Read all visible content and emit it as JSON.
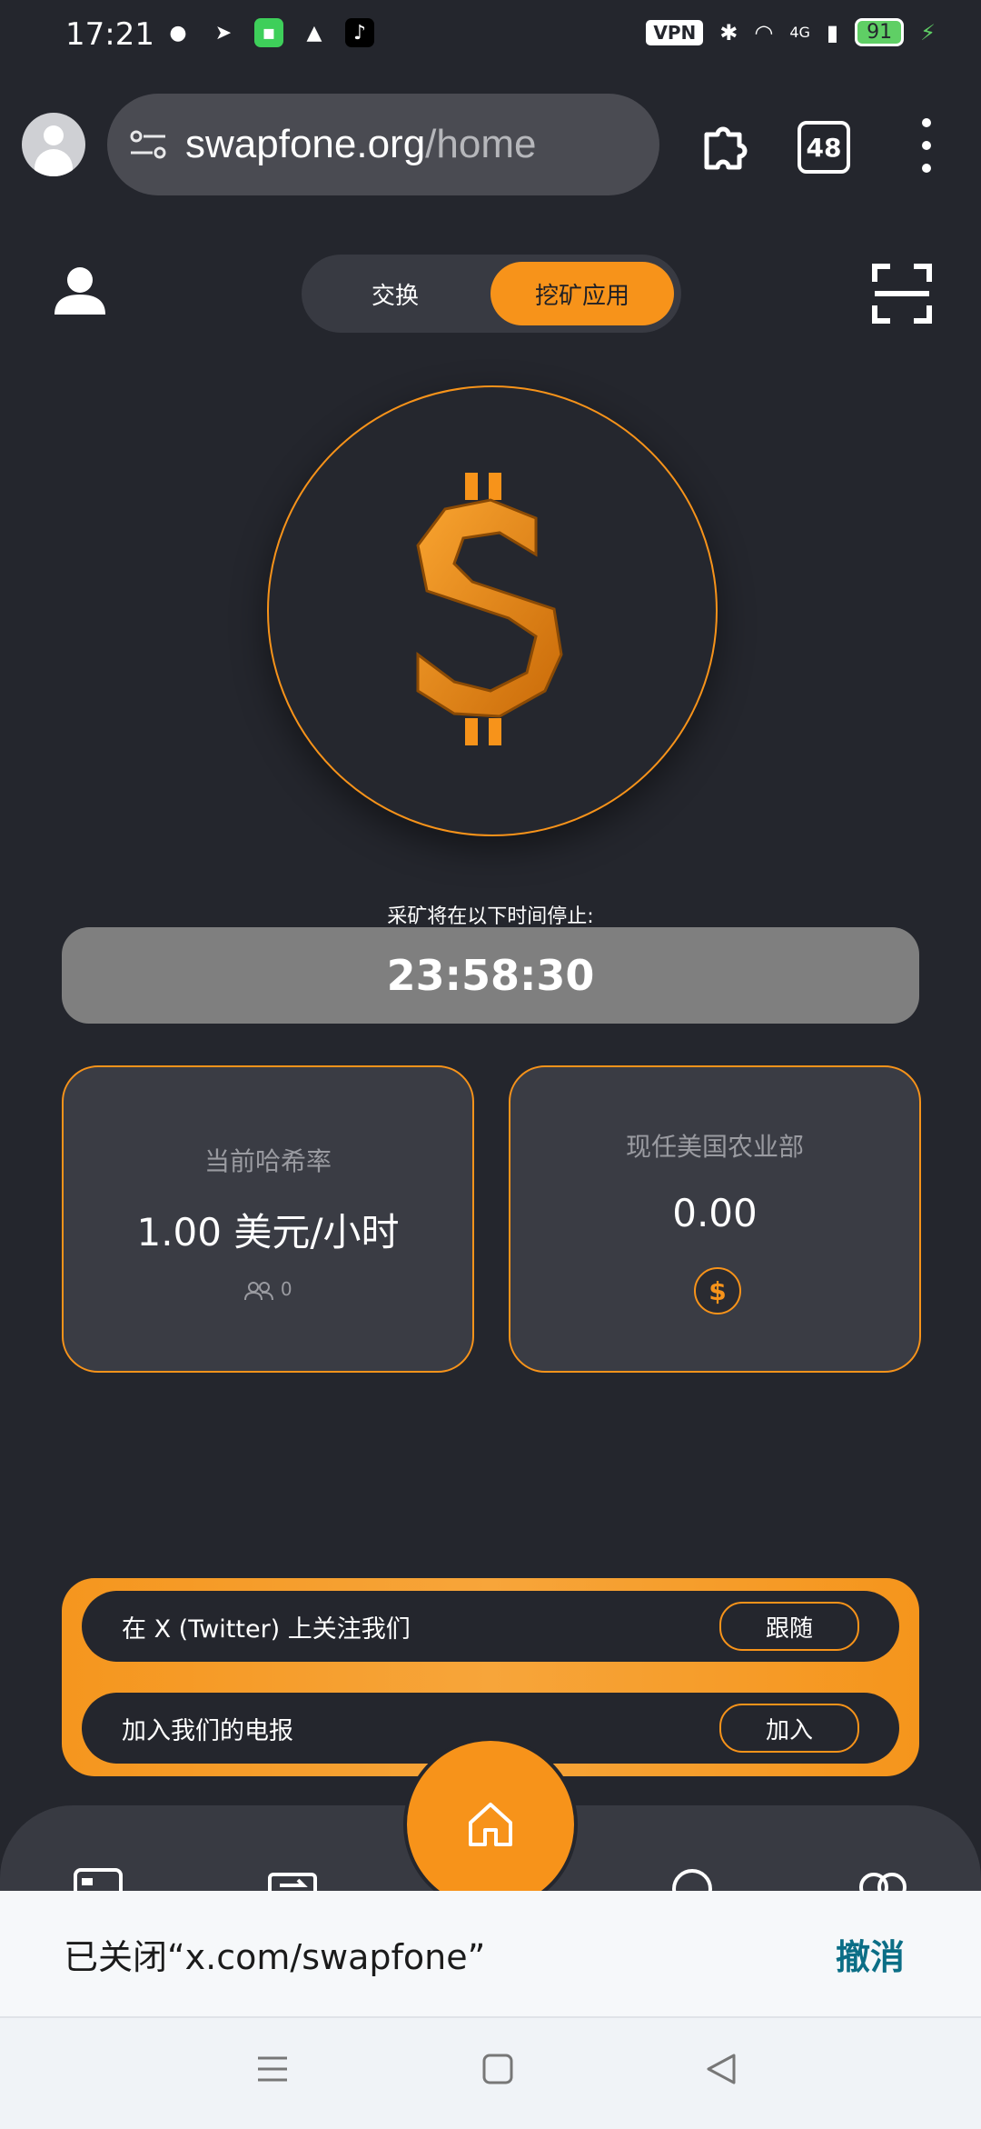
{
  "status_bar": {
    "time": "17:21",
    "vpn": "VPN",
    "network": "4G",
    "battery": "91"
  },
  "browser": {
    "url_domain": "swapfone.org",
    "url_path": "/home",
    "tab_count": "48"
  },
  "app": {
    "tabs": {
      "swap": "交换",
      "mining": "挖矿应用"
    },
    "timer_label": "采矿将在以下时间停止:",
    "timer_value": "23:58:30",
    "hash_card": {
      "title": "当前哈希率",
      "value": "1.00 美元/小时",
      "referrals": "0"
    },
    "balance_card": {
      "title": "现任美国农业部",
      "value": "0.00"
    },
    "social": {
      "twitter_label": "在 X (Twitter) 上关注我们",
      "twitter_button": "跟随",
      "telegram_label": "加入我们的电报",
      "telegram_button": "加入"
    }
  },
  "snackbar": {
    "message": "已关闭“x.com/swapfone”",
    "action": "撤消"
  },
  "colors": {
    "accent": "#f7931a",
    "background": "#24262d",
    "card": "#3a3c44",
    "undo": "#0b6e86"
  }
}
